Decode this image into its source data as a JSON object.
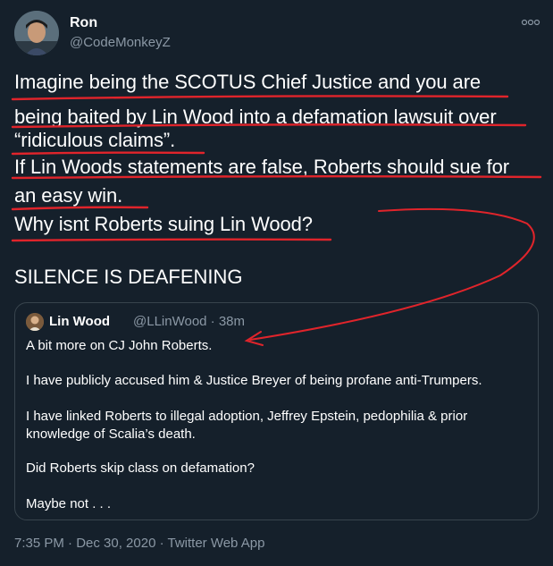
{
  "author": {
    "name": "Ron",
    "handle": "@CodeMonkeyZ"
  },
  "tweet": {
    "lines": [
      "Imagine being the SCOTUS Chief Justice and you are",
      "being baited by Lin Wood into a defamation lawsuit over",
      "“ridiculous claims”.",
      "If Lin Woods statements are false, Roberts should sue for",
      "an easy win.",
      "Why isnt Roberts suing Lin Wood?"
    ],
    "emphasis": "SILENCE IS DEAFENING"
  },
  "quoted_tweet": {
    "name": "Lin Wood",
    "meta": "@LLinWood · 38m",
    "paragraphs": [
      "A bit more on CJ John Roberts.",
      "I have publicly accused him & Justice Breyer of being profane anti-Trumpers.",
      "I have linked Roberts to illegal adoption, Jeffrey Epstein, pedophilia & prior",
      "knowledge of Scalia’s death.",
      "Did Roberts skip class on defamation?",
      "Maybe not . . ."
    ]
  },
  "footer": {
    "meta": "7:35 PM · Dec 30, 2020 · Twitter Web App"
  },
  "colors": {
    "background": "#15202b",
    "annotation_red": "#e0242b",
    "secondary_text": "#8b98a5",
    "border": "#38444d"
  },
  "icons": [
    "more-options-icon",
    "avatar-image",
    "quoted-avatar-image"
  ]
}
